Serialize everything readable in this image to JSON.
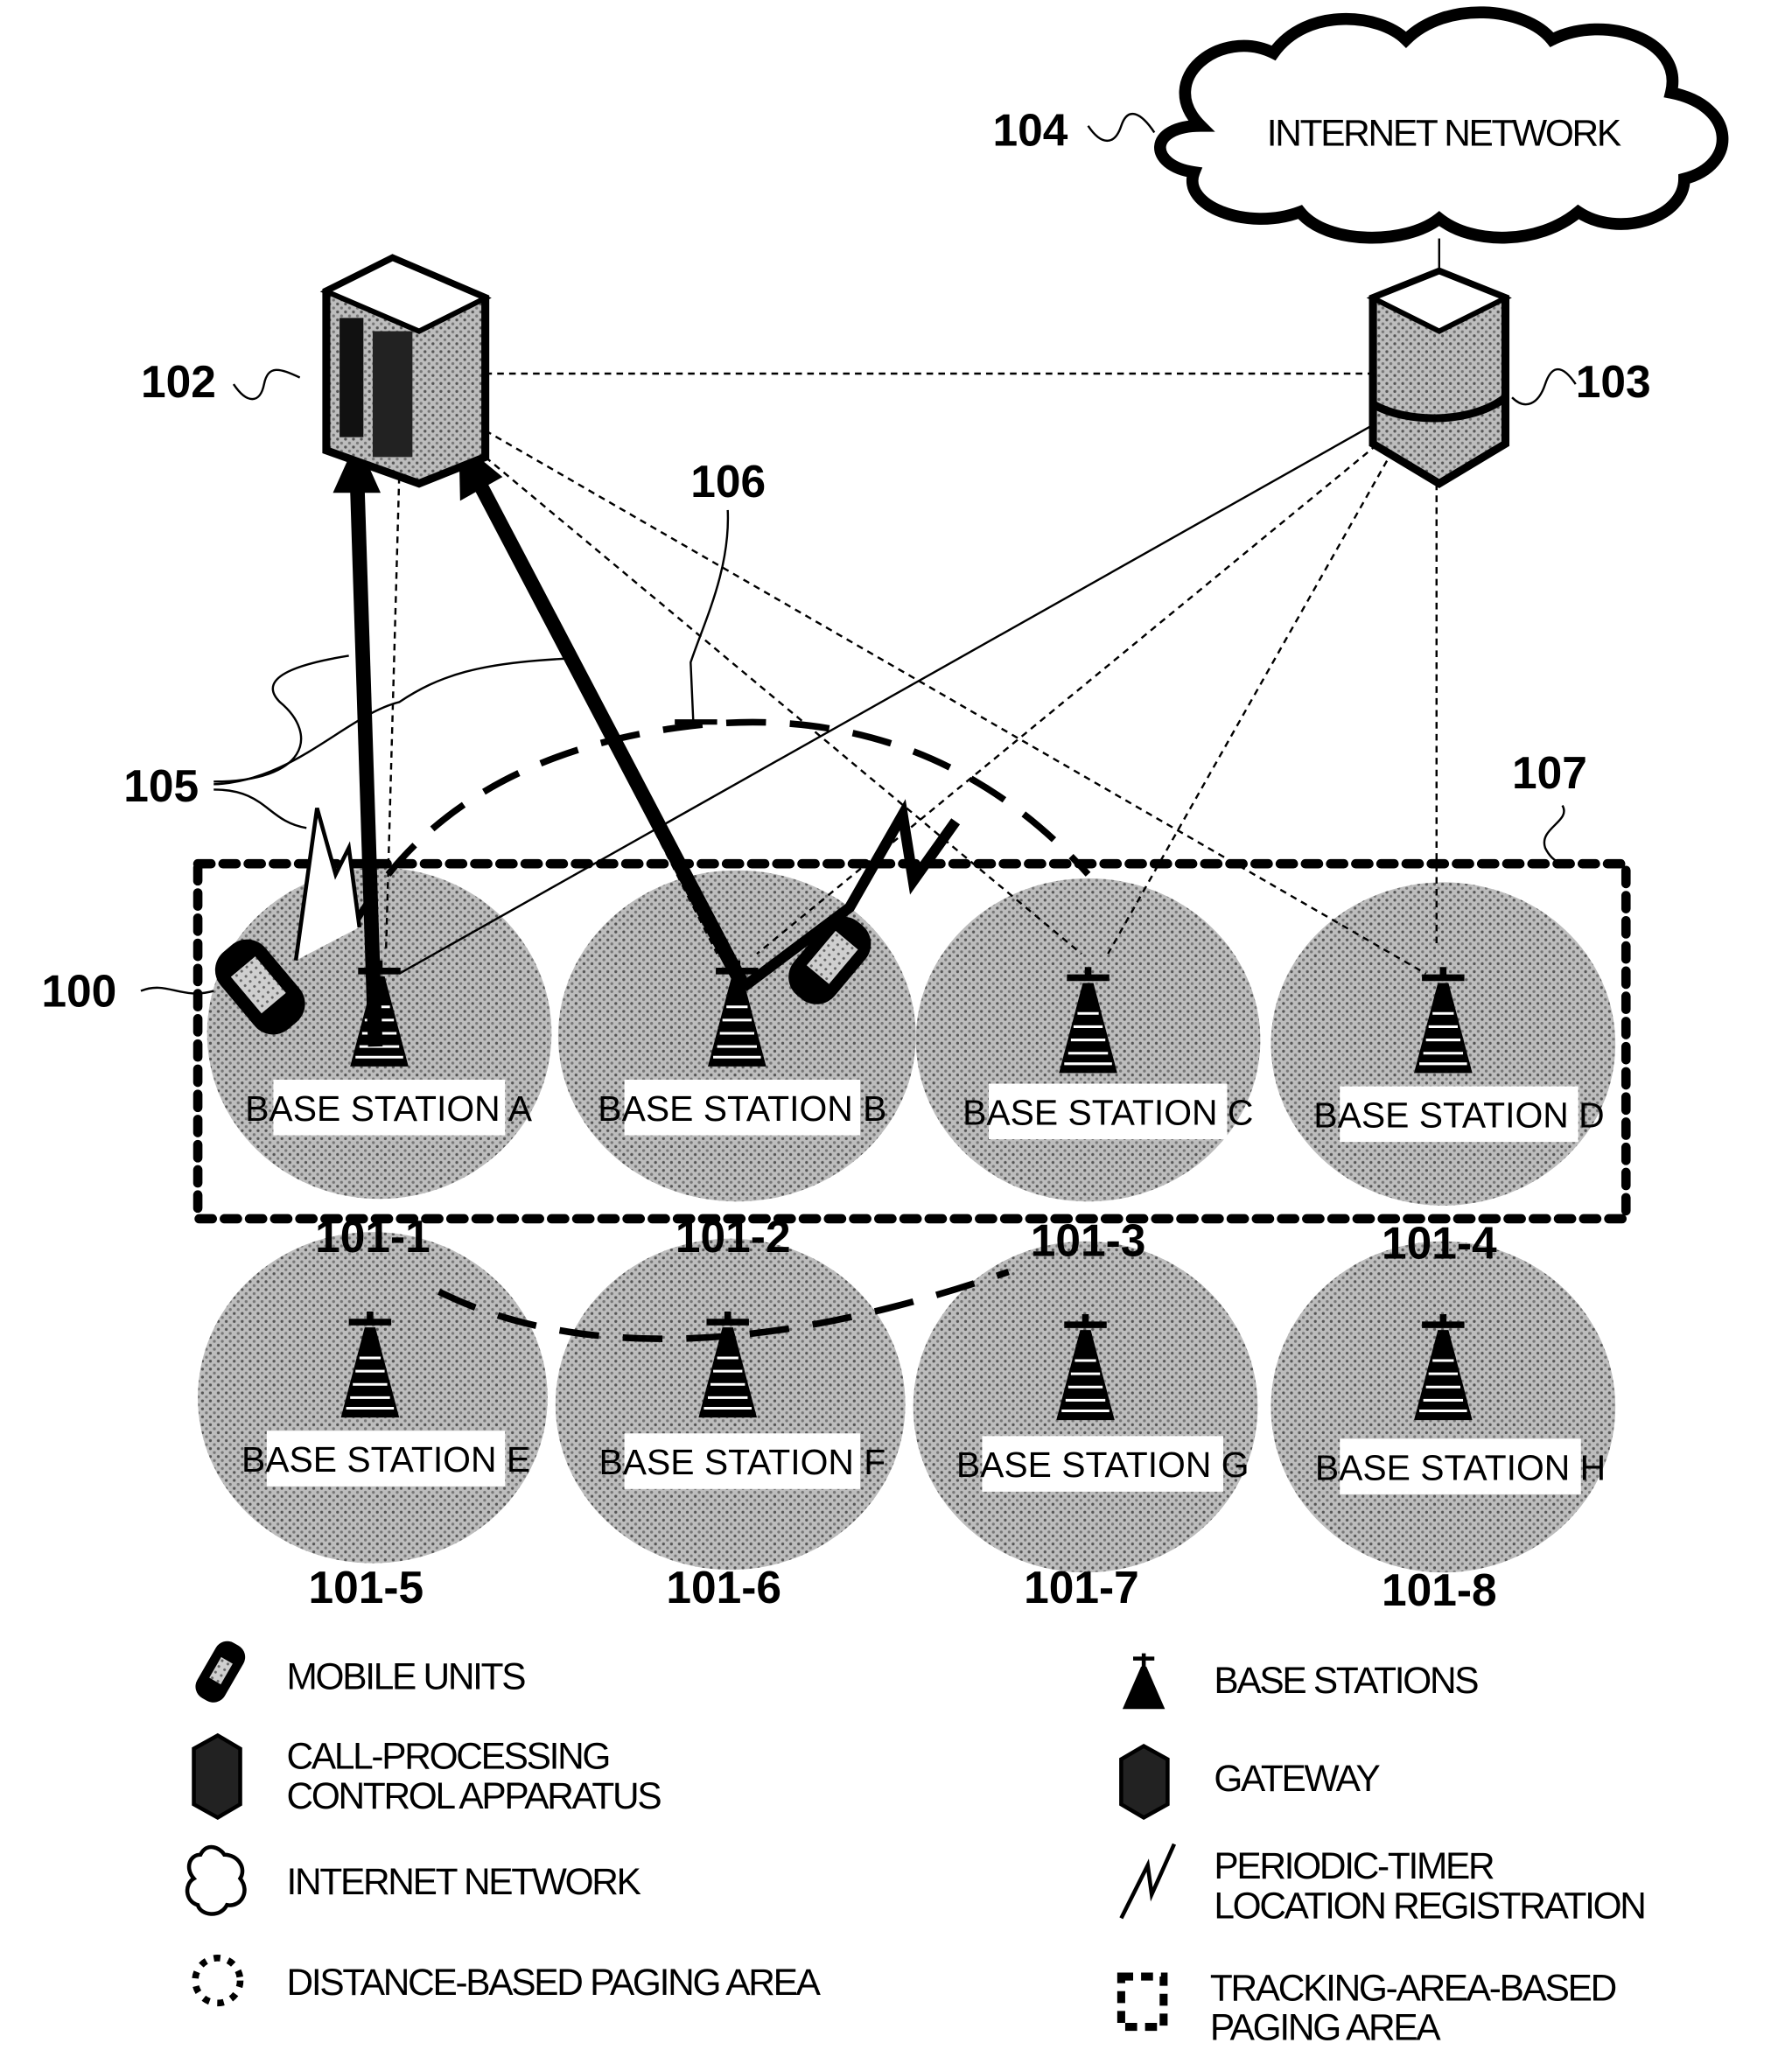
{
  "figure": {
    "internet": {
      "ref": "104",
      "label": "INTERNET NETWORK"
    },
    "call_processing": {
      "ref": "102"
    },
    "gateway": {
      "ref": "103"
    },
    "mobile_unit": {
      "ref": "100"
    },
    "registration": {
      "ref": "105"
    },
    "distance_area": {
      "ref": "106"
    },
    "tracking_area": {
      "ref": "107"
    },
    "base_stations": [
      {
        "ref": "101-1",
        "label": "BASE STATION A"
      },
      {
        "ref": "101-2",
        "label": "BASE STATION B"
      },
      {
        "ref": "101-3",
        "label": "BASE STATION C"
      },
      {
        "ref": "101-4",
        "label": "BASE STATION D"
      },
      {
        "ref": "101-5",
        "label": "BASE STATION E"
      },
      {
        "ref": "101-6",
        "label": "BASE STATION F"
      },
      {
        "ref": "101-7",
        "label": "BASE STATION G"
      },
      {
        "ref": "101-8",
        "label": "BASE STATION H"
      }
    ]
  },
  "legend": {
    "mobile_units": "MOBILE UNITS",
    "call_processing_1": "CALL-PROCESSING",
    "call_processing_2": "CONTROL APPARATUS",
    "internet": "INTERNET NETWORK",
    "distance_area": "DISTANCE-BASED PAGING AREA",
    "base_stations": "BASE STATIONS",
    "gateway": "GATEWAY",
    "periodic_1": "PERIODIC-TIMER",
    "periodic_2": "LOCATION REGISTRATION",
    "tracking_1": "TRACKING-AREA-BASED",
    "tracking_2": "PAGING AREA"
  }
}
